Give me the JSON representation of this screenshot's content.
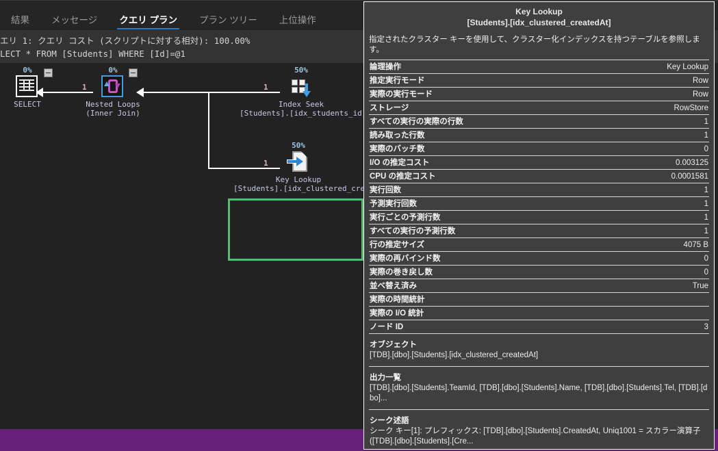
{
  "tabs": [
    {
      "label": "結果",
      "active": false
    },
    {
      "label": "メッセージ",
      "active": false
    },
    {
      "label": "クエリ プラン",
      "active": true
    },
    {
      "label": "プラン ツリー",
      "active": false
    },
    {
      "label": "上位操作",
      "active": false
    }
  ],
  "query_header": {
    "cost_line": "エリ 1: クエリ コスト (スクリプトに対する相対): 100.00%",
    "sql_line": "LECT * FROM [Students] WHERE [Id]=@1"
  },
  "plan": {
    "nodes": [
      {
        "id": "select",
        "percent": "0%",
        "caption1": "SELECT",
        "caption2": "",
        "icon": "select-grid-icon"
      },
      {
        "id": "nested-loops",
        "percent": "0%",
        "caption1": "Nested Loops",
        "caption2": "(Inner Join)",
        "icon": "nested-loops-icon"
      },
      {
        "id": "index-seek",
        "percent": "50%",
        "caption1": "Index Seek",
        "caption2": "[Students].[idx_students_id]",
        "icon": "index-seek-icon"
      },
      {
        "id": "key-lookup",
        "percent": "50%",
        "caption1": "Key Lookup",
        "caption2": "[Students].[idx_clustered_createdAt]",
        "icon": "key-lookup-icon"
      }
    ],
    "row_labels": {
      "select_in": "1",
      "seek_out": "1",
      "lookup_out": "1"
    },
    "selection_color": "#5cb874"
  },
  "tooltip": {
    "title_line1": "Key Lookup",
    "title_line2": "[Students].[idx_clustered_createdAt]",
    "description": "指定されたクラスター キーを使用して、クラスター化インデックスを持つテーブルを参照します。",
    "rows": [
      {
        "key": "論理操作",
        "value": "Key Lookup"
      },
      {
        "key": "推定実行モード",
        "value": "Row"
      },
      {
        "key": "実際の実行モード",
        "value": "Row"
      },
      {
        "key": "ストレージ",
        "value": "RowStore"
      },
      {
        "key": "すべての実行の実際の行数",
        "value": "1"
      },
      {
        "key": "読み取った行数",
        "value": "1"
      },
      {
        "key": "実際のバッチ数",
        "value": "0"
      },
      {
        "key": "I/O の推定コスト",
        "value": "0.003125"
      },
      {
        "key": "CPU の推定コスト",
        "value": "0.0001581"
      },
      {
        "key": "実行回数",
        "value": "1"
      },
      {
        "key": "予測実行回数",
        "value": "1"
      },
      {
        "key": "実行ごとの予測行数",
        "value": "1"
      },
      {
        "key": "すべての実行の予測行数",
        "value": "1"
      },
      {
        "key": "行の推定サイズ",
        "value": "4075 B"
      },
      {
        "key": "実際の再バインド数",
        "value": "0"
      },
      {
        "key": "実際の巻き戻し数",
        "value": "0"
      },
      {
        "key": "並べ替え済み",
        "value": "True"
      },
      {
        "key": "実際の時間統計",
        "value": ""
      },
      {
        "key": "実際の I/O 統計",
        "value": ""
      },
      {
        "key": "ノード ID",
        "value": "3"
      }
    ],
    "blocks": [
      {
        "key": "オブジェクト",
        "value": "[TDB].[dbo].[Students].[idx_clustered_createdAt]"
      },
      {
        "key": "出力一覧",
        "value": "[TDB].[dbo].[Students].TeamId, [TDB].[dbo].[Students].Name, [TDB].[dbo].[Students].Tel, [TDB].[dbo]..."
      },
      {
        "key": "シーク述語",
        "value": "シーク キー[1]: プレフィックス: [TDB].[dbo].[Students].CreatedAt, Uniq1001 = スカラー演算子([TDB].[dbo].[Students].[Cre..."
      }
    ]
  },
  "colors": {
    "accent_blue": "#1f7fd0",
    "status_purple": "#68217a",
    "selection_green": "#5cb874",
    "tooltip_bg": "#3f3f3f"
  }
}
